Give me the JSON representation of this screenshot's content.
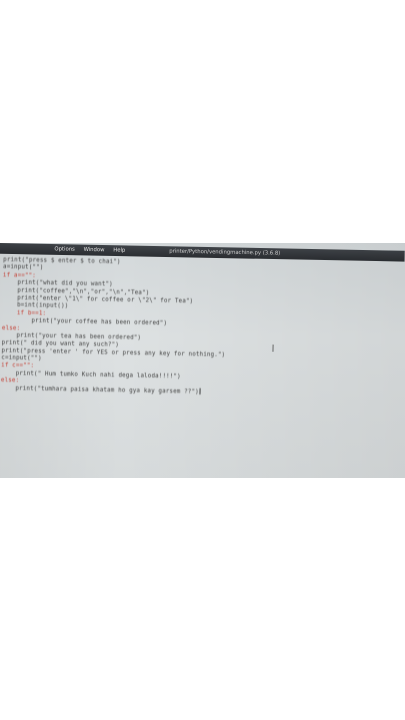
{
  "window": {
    "title": "printer/Python/vendingmachine.py (3.6.8)",
    "menu": [
      "Options",
      "Window",
      "Help"
    ]
  },
  "code_lines": [
    {
      "text": "print(\"press $ enter $ to chai\")",
      "kw": false
    },
    {
      "text": "a=input(\"\")",
      "kw": false
    },
    {
      "text": "if a==\"\":",
      "kw": true
    },
    {
      "text": "    print(\"what did you want\")",
      "kw": false
    },
    {
      "text": "    print(\"coffee\",\"\\n\",\"or\",\"\\n\",\"Tea\")",
      "kw": false
    },
    {
      "text": "    print(\"enter \\\"1\\\" for coffee or \\\"2\\\" for Tea\")",
      "kw": false
    },
    {
      "text": "    b=int(input())",
      "kw": false
    },
    {
      "text": "    if b==1:",
      "kw": true
    },
    {
      "text": "        print(\"your coffee has been ordered\")",
      "kw": false
    },
    {
      "text": "else:",
      "kw": true
    },
    {
      "text": "    print(\"your tea has been ordered\")",
      "kw": false
    },
    {
      "text": "print(\" did you want any such?\")",
      "kw": false
    },
    {
      "text": "print(\"press 'enter ' for YES or press any key for nothing.\")",
      "kw": false
    },
    {
      "text": "c=input(\"\")",
      "kw": false
    },
    {
      "text": "if c==\"\":",
      "kw": true
    },
    {
      "text": "    print(\" Hum tumko Kuch nahi dega laloda!!!!\")",
      "kw": false
    },
    {
      "text": "else:",
      "kw": true
    },
    {
      "text": "    print(\"tumhara paisa khatam ho gya kay garsem ??\")",
      "kw": false
    }
  ]
}
